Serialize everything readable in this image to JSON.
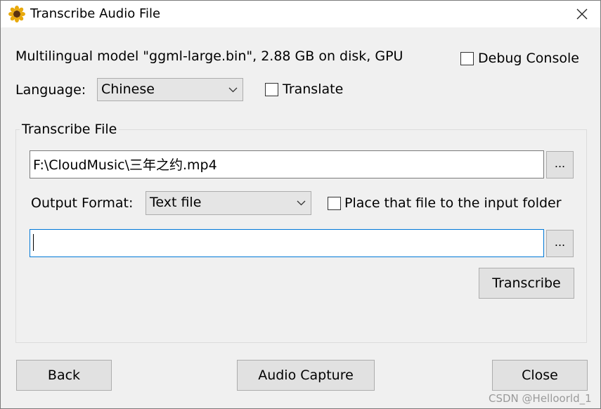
{
  "window": {
    "title": "Transcribe Audio File",
    "app_icon": "sunflower-icon",
    "close_icon": "close-icon"
  },
  "model_info": "Multilingual model \"ggml-large.bin\", 2.88 GB on disk, GPU",
  "debug_console": {
    "label": "Debug Console",
    "checked": false
  },
  "language": {
    "label": "Language:",
    "selected": "Chinese"
  },
  "translate": {
    "label": "Translate",
    "checked": false
  },
  "group": {
    "title": "Transcribe File",
    "input_file": "F:\\CloudMusic\\三年之约.mp4",
    "browse_label": "...",
    "output_format": {
      "label": "Output Format:",
      "selected": "Text file"
    },
    "place_in_input_folder": {
      "label": "Place that file to the input folder",
      "checked": false
    },
    "output_file": "",
    "transcribe_label": "Transcribe"
  },
  "footer": {
    "back_label": "Back",
    "audio_capture_label": "Audio Capture",
    "close_label": "Close"
  },
  "watermark": "CSDN @Helloorld_1"
}
